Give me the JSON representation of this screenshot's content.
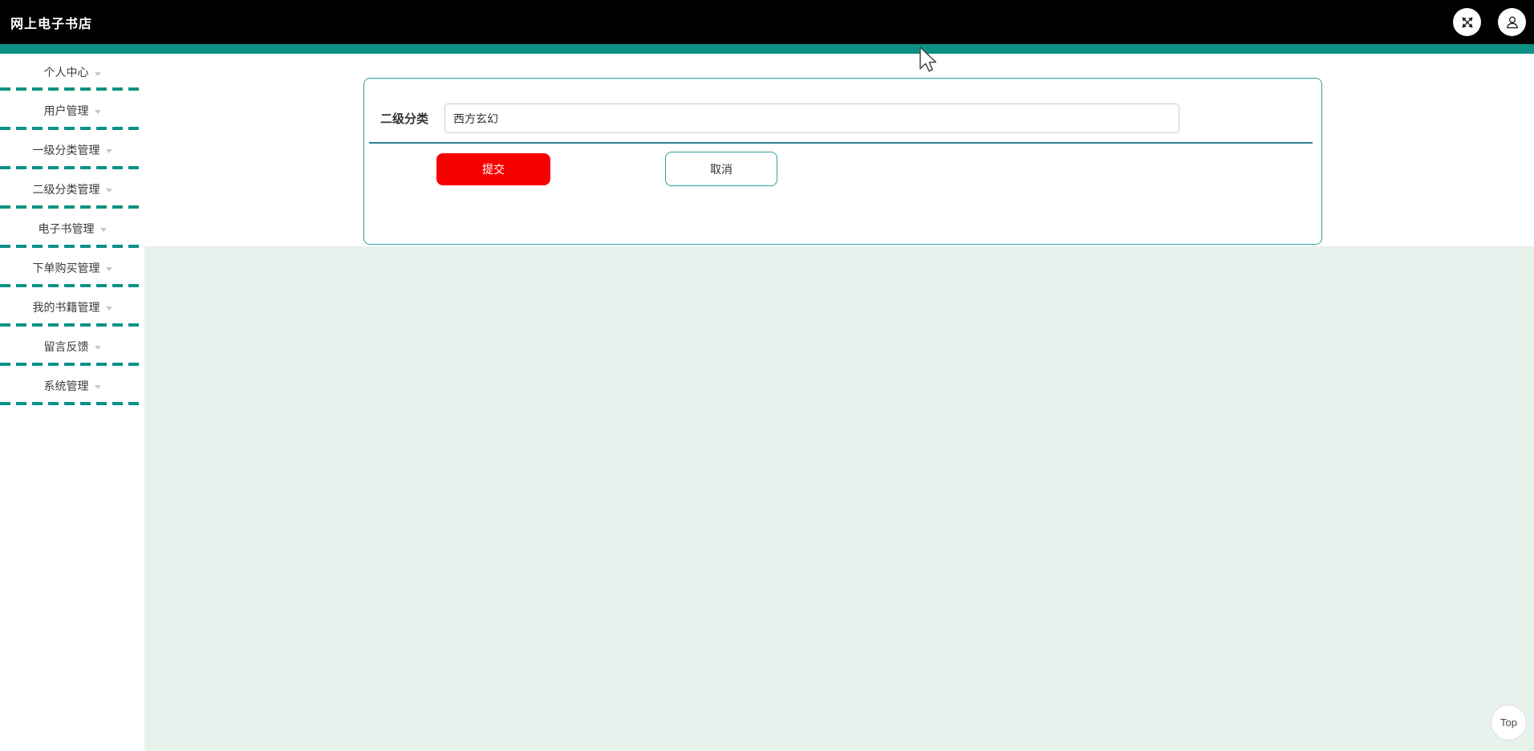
{
  "header": {
    "title": "网上电子书店",
    "icons": {
      "fullscreen": "expand-arrows",
      "user": "person-silhouette"
    }
  },
  "sidebar": {
    "items": [
      "个人中心",
      "用户管理",
      "一级分类管理",
      "二级分类管理",
      "电子书管理",
      "下单购买管理",
      "我的书籍管理",
      "留言反馈",
      "系统管理"
    ]
  },
  "form": {
    "category_label": "二级分类",
    "category_value": "西方玄幻",
    "submit_label": "提交",
    "cancel_label": "取消"
  },
  "misc": {
    "back_to_top_label": "Top"
  },
  "colors": {
    "teal": "#0e9185",
    "card_border": "#27a39e",
    "divider": "#2e8192",
    "submit_red": "#f80000",
    "page_bg_green": "#e8f2ec",
    "header_bg": "#000000"
  }
}
